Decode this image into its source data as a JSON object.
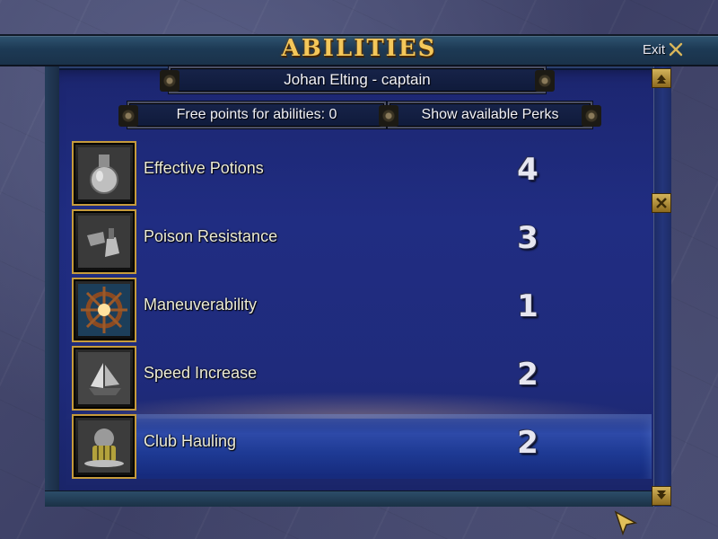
{
  "screen": {
    "title": "ABILITIES",
    "exit_label": "Exit",
    "character_name": "Johan Elting - captain",
    "free_points_label": "Free points for abilities: 0",
    "show_perks_label": "Show available Perks"
  },
  "abilities": [
    {
      "name": "Effective Potions",
      "level": "4",
      "icon": "potion-flask-icon"
    },
    {
      "name": "Poison Resistance",
      "level": "3",
      "icon": "poison-flask-icon"
    },
    {
      "name": "Maneuverability",
      "level": "1",
      "icon": "ship-wheel-icon"
    },
    {
      "name": "Speed Increase",
      "level": "2",
      "icon": "sailing-ship-icon"
    },
    {
      "name": "Club Hauling",
      "level": "2",
      "icon": "anchor-chain-icon",
      "selected": true
    }
  ],
  "colors": {
    "title_gold": "#f4c75a",
    "panel_blue": "#202d82",
    "frame_gold": "#c69b3c"
  }
}
